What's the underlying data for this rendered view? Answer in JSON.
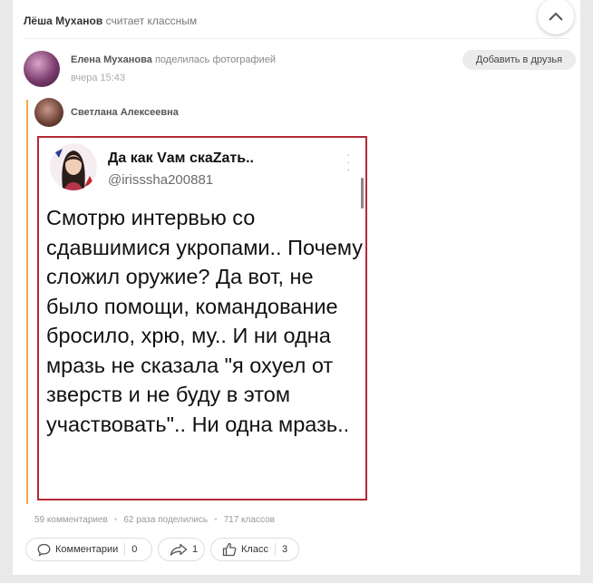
{
  "activity": {
    "actor": "Лёша Муханов",
    "action": "считает классным"
  },
  "post": {
    "author": "Елена Муханова",
    "action": "поделилась фотографией",
    "time": "вчера 15:43",
    "add_friend_label": "Добавить в друзья"
  },
  "original": {
    "author": "Светлана Алексеевна"
  },
  "tweet": {
    "name": "Да как Vам скаZать..",
    "handle": "@irisssha200881",
    "text": "Смотрю интервью со сдавшимися укропами.. Почему сложил оружие? Да вот, не было помощи, командование бросило, хрю, му.. И ни одна мразь не сказала \"я охуел от зверств и не буду в этом участвовать\".. Ни одна мразь.."
  },
  "stats": {
    "comments": "59 комментариев",
    "shares": "62 раза поделились",
    "likes": "717 классов"
  },
  "actions": {
    "comments_label": "Комментарии",
    "comments_count": "0",
    "share_count": "1",
    "like_label": "Класс",
    "like_count": "3"
  },
  "colors": {
    "repost_line": "#f7a84a",
    "photo_border": "#b32a35"
  },
  "icons": {
    "scroll_up": "chevron-up-icon",
    "comment": "comment-icon",
    "share": "share-icon",
    "like": "thumbs-up-icon"
  }
}
